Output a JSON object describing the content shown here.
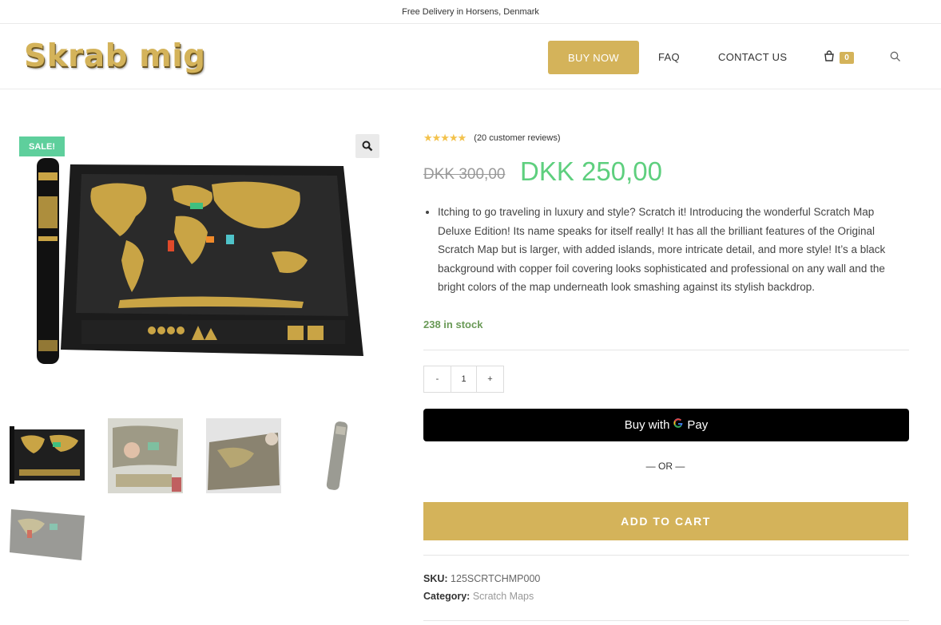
{
  "topbar": {
    "text": "Free Delivery in Horsens, Denmark"
  },
  "header": {
    "logo": "Skrab mig",
    "nav": {
      "buy_now": "BUY NOW",
      "faq": "FAQ",
      "contact": "CONTACT US"
    },
    "cart_count": "0",
    "icons": {
      "cart": "shopping-bag-icon",
      "search": "search-icon"
    }
  },
  "gallery": {
    "sale_badge": "SALE!",
    "zoom_icon": "magnifier-icon",
    "thumbnails": [
      "thumbnail-1",
      "thumbnail-2",
      "thumbnail-3",
      "thumbnail-4",
      "thumbnail-5"
    ]
  },
  "product": {
    "rating": 5,
    "stars": "★★★★★",
    "reviews": "(20 customer reviews)",
    "price_old": "DKK 300,00",
    "price_new": "DKK 250,00",
    "description": "Itching to go traveling in luxury and style? Scratch it! Introducing the wonderful Scratch Map Deluxe Edition! Its name speaks for itself really! It has all the brilliant features of the Original Scratch Map but is larger, with added islands, more intricate detail, and more style! It’s a black background with copper foil covering looks sophisticated and professional on any wall and the bright colors of the map underneath look smashing against its stylish backdrop.",
    "stock": "238 in stock",
    "quantity": {
      "minus": "-",
      "value": "1",
      "plus": "+"
    },
    "gpay": {
      "prefix": "Buy with",
      "g": "G",
      "pay": "Pay"
    },
    "or": "— OR —",
    "add_to_cart": "ADD TO CART",
    "sku_label": "SKU:",
    "sku": "125SCRTCHMP000",
    "category_label": "Category:",
    "category": "Scratch Maps"
  },
  "colors": {
    "accent": "#d4b35a",
    "sale": "#5ecf9c",
    "price": "#5ecf7e",
    "stock": "#6a9a57"
  }
}
